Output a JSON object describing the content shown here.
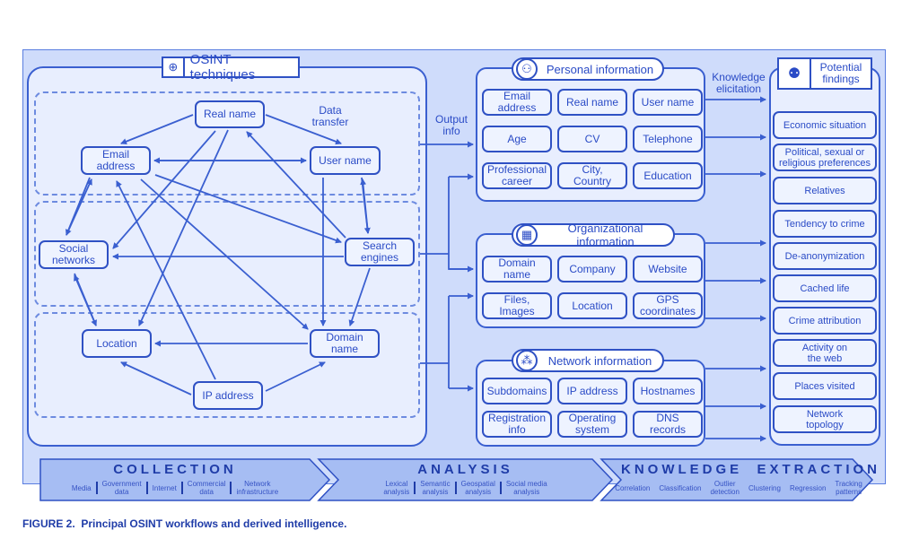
{
  "caption": {
    "figure_label": "FIGURE 2.",
    "text": "Principal OSINT workflows and derived intelligence."
  },
  "techniques": {
    "title": "OSINT techniques",
    "icon": "globe-network-icon",
    "data_transfer_label": "Data\ntransfer",
    "nodes": {
      "real_name": "Real name",
      "email_address": "Email\naddress",
      "user_name": "User name",
      "social_networks": "Social\nnetworks",
      "search_engines": "Search\nengines",
      "location": "Location",
      "domain_name": "Domain\nname",
      "ip_address": "IP address"
    }
  },
  "output_info_label": "Output\ninfo",
  "knowledge_elicitation_label": "Knowledge\nelicitation",
  "personal": {
    "title": "Personal information",
    "icon": "user-icon",
    "items": [
      "Email\naddress",
      "Real name",
      "User name",
      "Age",
      "CV",
      "Telephone",
      "Professional\ncareer",
      "City,\nCountry",
      "Education"
    ]
  },
  "organizational": {
    "title": "Organizational information",
    "icon": "building-icon",
    "items": [
      "Domain\nname",
      "Company",
      "Website",
      "Files,\nImages",
      "Location",
      "GPS\ncoordinates"
    ]
  },
  "network": {
    "title": "Network information",
    "icon": "network-nodes-icon",
    "items": [
      "Subdomains",
      "IP address",
      "Hostnames",
      "Registration\ninfo",
      "Operating\nsystem",
      "DNS\nrecords"
    ]
  },
  "findings": {
    "title": "Potential\nfindings",
    "icon": "group-focus-icon",
    "items": [
      "Economic situation",
      "Political, sexual or\nreligious preferences",
      "Relatives",
      "Tendency to crime",
      "De-anonymization",
      "Cached life",
      "Crime attribution",
      "Activity on\nthe web",
      "Places visited",
      "Network\ntopology"
    ]
  },
  "stages": [
    {
      "title": "COLLECTION",
      "items": [
        "Media",
        "Government\ndata",
        "Internet",
        "Commercial\ndata",
        "Network\ninfrastructure"
      ]
    },
    {
      "title": "ANALYSIS",
      "items": [
        "Lexical\nanalysis",
        "Semantic\nanalysis",
        "Geospatial\nanalysis",
        "Social media\nanalysis"
      ]
    },
    {
      "title": "KNOWLEDGE  EXTRACTION",
      "items": [
        "Correlation",
        "Classification",
        "Outlier\ndetection",
        "Clustering",
        "Regression",
        "Tracking\npatterns"
      ]
    }
  ],
  "colors": {
    "primary": "#2f51c4",
    "panel_bg": "#e8eefe",
    "outer_bg": "#cfdcfb",
    "stage_bg": "#9db4f0"
  }
}
